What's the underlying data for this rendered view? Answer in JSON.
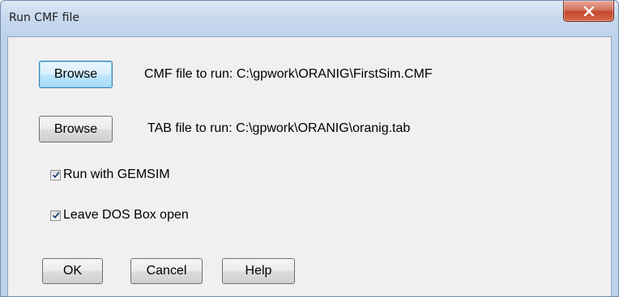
{
  "window": {
    "title": "Run CMF file"
  },
  "cmf": {
    "browse_label": "Browse",
    "label": "CMF file to run:",
    "path": "C:\\gpwork\\ORANIG\\FirstSim.CMF"
  },
  "tab": {
    "browse_label": "Browse",
    "label": "TAB file to run:",
    "path": "C:\\gpwork\\ORANIG\\oranig.tab"
  },
  "options": {
    "gemsim": {
      "label": "Run with GEMSIM",
      "checked": true
    },
    "dosbox": {
      "label": "Leave DOS Box open",
      "checked": true
    }
  },
  "buttons": {
    "ok": "OK",
    "cancel": "Cancel",
    "help": "Help"
  },
  "icons": {
    "close": "close-x-icon",
    "check": "checkmark-icon"
  },
  "colors": {
    "title_bar": "#c8d9ee",
    "close_button": "#c4462b",
    "dialog_body": "#f0f0f0",
    "focus_border": "#3c7fb1",
    "check_mark": "#1f3d7a"
  }
}
